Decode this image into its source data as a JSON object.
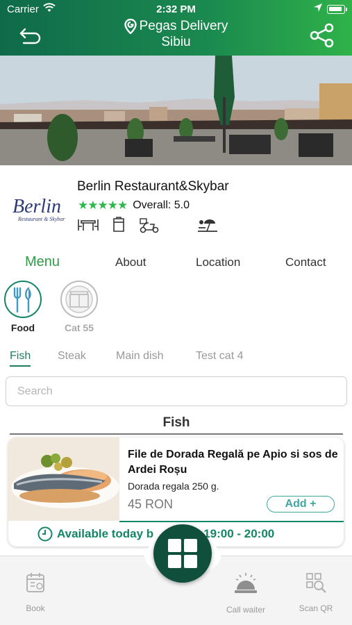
{
  "status_bar": {
    "carrier": "Carrier",
    "time": "2:32 PM"
  },
  "header": {
    "title_line1": "Pegas Delivery",
    "title_line2": "Sibiu"
  },
  "restaurant": {
    "name": "Berlin Restaurant&Skybar",
    "stars": "★★★★★",
    "rating": 5.0,
    "overall_label": "Overall: 5.0",
    "logo_text": "Berlin",
    "logo_subtext": "Restaurant & Skybar",
    "services": [
      "dine-in-icon",
      "takeaway-icon",
      "delivery-icon",
      "terrace-icon"
    ]
  },
  "tabs": [
    {
      "label": "Menu",
      "active": true
    },
    {
      "label": "About",
      "active": false
    },
    {
      "label": "Location",
      "active": false
    },
    {
      "label": "Contact",
      "active": false
    }
  ],
  "categories": [
    {
      "label": "Food",
      "active": true,
      "icon": "fork-knife-icon"
    },
    {
      "label": "Cat 55",
      "active": false,
      "icon": "category-image-icon"
    }
  ],
  "subcategories": [
    {
      "label": "Fish",
      "active": true
    },
    {
      "label": "Steak",
      "active": false
    },
    {
      "label": "Main dish",
      "active": false
    },
    {
      "label": "Test cat 4",
      "active": false
    }
  ],
  "search": {
    "placeholder": "Search"
  },
  "section": {
    "title": "Fish"
  },
  "product": {
    "title": "File de Dorada Regală pe Apio si sos de Ardei Roșu",
    "description": "Dorada regala 250 g.",
    "price": "45 RON",
    "add_label": "Add +",
    "availability_before": "Available today b",
    "availability_after": " 19:00 - 20:00"
  },
  "bottom_bar": {
    "book_label": "Book",
    "call_waiter_label": "Call waiter",
    "scan_qr_label": "Scan QR"
  },
  "colors": {
    "brand_dark": "#0f4f3c",
    "brand_green": "#2e9b47",
    "header_start": "#0f6a4a",
    "header_end": "#2fb24a",
    "star": "#2eb84b",
    "add_button": "#3fa6a0"
  }
}
